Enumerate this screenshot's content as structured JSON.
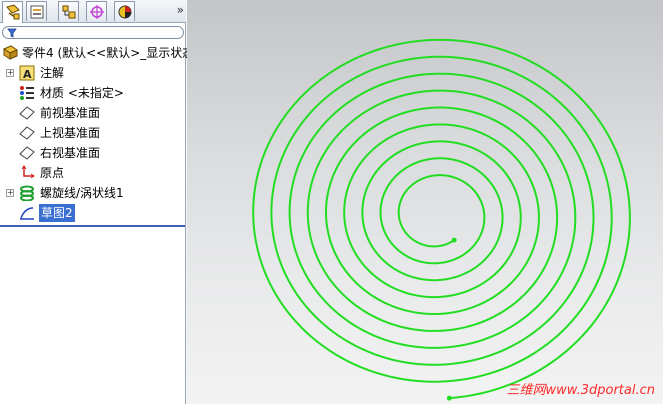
{
  "tabs": [
    {
      "name": "featuremanager",
      "icon": "featuremanager-tree-icon",
      "active": true
    },
    {
      "name": "propertymanager",
      "icon": "propertymanager-icon",
      "active": false
    },
    {
      "name": "configurationmanager",
      "icon": "configurationmanager-icon",
      "active": false
    },
    {
      "name": "dimxpert",
      "icon": "dimxpert-icon",
      "active": false
    },
    {
      "name": "display-manager",
      "icon": "appearance-sphere-icon",
      "active": false
    }
  ],
  "tab_overflow_label": "»",
  "filter": {
    "icon": "filter-funnel-icon"
  },
  "tree": {
    "root": "零件4  (默认<<默认>_显示状态",
    "items": [
      {
        "label": "注解",
        "icon": "annotations-icon",
        "expander": "+"
      },
      {
        "label": "材质 <未指定>",
        "icon": "material-icon",
        "expander": ""
      },
      {
        "label": "前视基准面",
        "icon": "plane-icon",
        "expander": ""
      },
      {
        "label": "上视基准面",
        "icon": "plane-icon",
        "expander": ""
      },
      {
        "label": "右视基准面",
        "icon": "plane-icon",
        "expander": ""
      },
      {
        "label": "原点",
        "icon": "origin-icon",
        "expander": ""
      },
      {
        "label": "螺旋线/涡状线1",
        "icon": "helix-icon",
        "expander": "+"
      },
      {
        "label": "草图2",
        "icon": "sketch-icon",
        "expander": "",
        "selected": true
      }
    ]
  },
  "viewport": {
    "spiral_color": "#22dd22",
    "watermark": "三维网www.3dportal.cn"
  }
}
